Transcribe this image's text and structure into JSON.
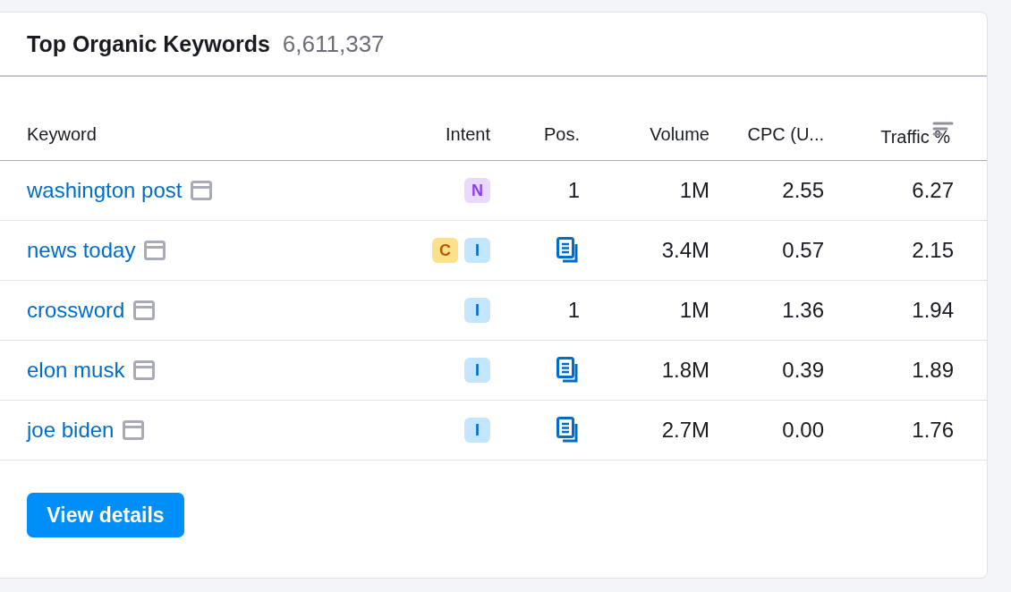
{
  "card": {
    "title": "Top Organic Keywords",
    "count": "6,611,337"
  },
  "table": {
    "columns": [
      {
        "label": "Keyword",
        "sorted": false
      },
      {
        "label": "Intent",
        "sorted": false
      },
      {
        "label": "Pos.",
        "sorted": false
      },
      {
        "label": "Volume",
        "sorted": false
      },
      {
        "label": "CPC (U...",
        "sorted": false
      },
      {
        "label": "Traffic %",
        "sorted": true
      }
    ],
    "rows": [
      {
        "keyword": "washington post",
        "intents": [
          {
            "label": "N",
            "kind": "navigational"
          }
        ],
        "position": {
          "kind": "number",
          "text": "1"
        },
        "volume": "1M",
        "cpc": "2.55",
        "traffic": "6.27"
      },
      {
        "keyword": "news today",
        "intents": [
          {
            "label": "C",
            "kind": "commercial"
          },
          {
            "label": "I",
            "kind": "informational"
          }
        ],
        "position": {
          "kind": "serp"
        },
        "volume": "3.4M",
        "cpc": "0.57",
        "traffic": "2.15"
      },
      {
        "keyword": "crossword",
        "intents": [
          {
            "label": "I",
            "kind": "informational"
          }
        ],
        "position": {
          "kind": "number",
          "text": "1"
        },
        "volume": "1M",
        "cpc": "1.36",
        "traffic": "1.94"
      },
      {
        "keyword": "elon musk",
        "intents": [
          {
            "label": "I",
            "kind": "informational"
          }
        ],
        "position": {
          "kind": "serp"
        },
        "volume": "1.8M",
        "cpc": "0.39",
        "traffic": "1.89"
      },
      {
        "keyword": "joe biden",
        "intents": [
          {
            "label": "I",
            "kind": "informational"
          }
        ],
        "position": {
          "kind": "serp"
        },
        "volume": "2.7M",
        "cpc": "0.00",
        "traffic": "1.76"
      }
    ]
  },
  "button": {
    "label": "View details"
  }
}
